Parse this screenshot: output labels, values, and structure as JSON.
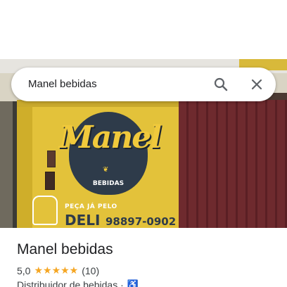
{
  "search": {
    "query": "Manel bebidas"
  },
  "photo": {
    "sign_word": "Manel",
    "sign_sub": "BEBIDAS",
    "painted_text_1": "PEÇA JÁ PELO",
    "painted_text_2": "DELI",
    "painted_phone": "98897-0902"
  },
  "place": {
    "name": "Manel bebidas",
    "rating": "5,0",
    "stars": "★★★★★",
    "review_count": "(10)",
    "category": "Distribuidor de bebidas ·",
    "accessibility_icon": "♿"
  },
  "colors": {
    "star": "#f5a623",
    "accent_blue": "#1a73e8"
  }
}
